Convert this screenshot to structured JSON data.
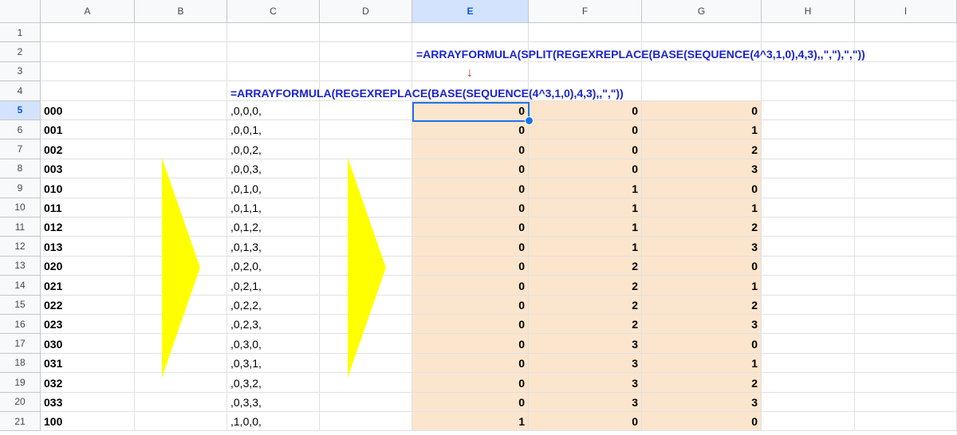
{
  "columns": [
    "A",
    "B",
    "C",
    "D",
    "E",
    "F",
    "G",
    "H",
    "I"
  ],
  "active_column": "E",
  "rows": [
    "1",
    "2",
    "3",
    "4",
    "5",
    "6",
    "7",
    "8",
    "9",
    "10",
    "11",
    "12",
    "13",
    "14",
    "15",
    "16",
    "17",
    "18",
    "19",
    "20",
    "21"
  ],
  "active_row": "5",
  "formulas": {
    "split_formula": "=ARRAYFORMULA(SPLIT(REGEXREPLACE(BASE(SEQUENCE(4^3,1,0),4,3),,\",\"),\",\"))",
    "regex_formula": "=ARRAYFORMULA(REGEXREPLACE(BASE(SEQUENCE(4^3,1,0),4,3),,\",\"))",
    "arrow_glyph": "↓"
  },
  "base_column": [
    "000",
    "001",
    "002",
    "003",
    "010",
    "011",
    "012",
    "013",
    "020",
    "021",
    "022",
    "023",
    "030",
    "031",
    "032",
    "033",
    "100"
  ],
  "regex_column": [
    ",0,0,0,",
    ",0,0,1,",
    ",0,0,2,",
    ",0,0,3,",
    ",0,1,0,",
    ",0,1,1,",
    ",0,1,2,",
    ",0,1,3,",
    ",0,2,0,",
    ",0,2,1,",
    ",0,2,2,",
    ",0,2,3,",
    ",0,3,0,",
    ",0,3,1,",
    ",0,3,2,",
    ",0,3,3,",
    ",1,0,0,"
  ],
  "split_columns": {
    "E": [
      "0",
      "0",
      "0",
      "0",
      "0",
      "0",
      "0",
      "0",
      "0",
      "0",
      "0",
      "0",
      "0",
      "0",
      "0",
      "0",
      "1"
    ],
    "F": [
      "0",
      "0",
      "0",
      "0",
      "1",
      "1",
      "1",
      "1",
      "2",
      "2",
      "2",
      "2",
      "3",
      "3",
      "3",
      "3",
      "0"
    ],
    "G": [
      "0",
      "1",
      "2",
      "3",
      "0",
      "1",
      "2",
      "3",
      "0",
      "1",
      "2",
      "3",
      "0",
      "1",
      "2",
      "3",
      "0"
    ]
  },
  "colors": {
    "accent": "#1a73e8",
    "tint": "#fce5cd",
    "formula_text": "#1a24cc",
    "arrow_shape": "#ffff00"
  }
}
